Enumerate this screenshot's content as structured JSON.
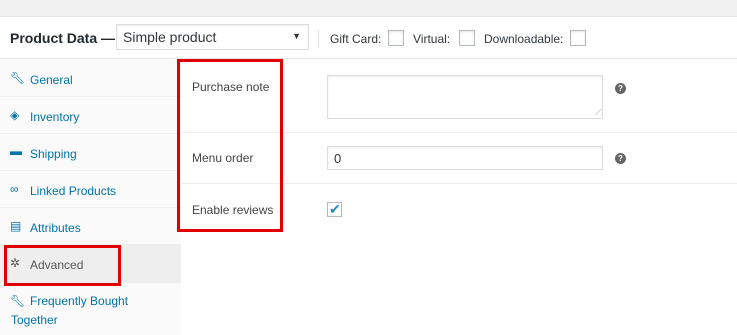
{
  "header": {
    "title": "Product Data —",
    "product_type": "Simple product",
    "options": [
      {
        "label": "Gift Card:",
        "checked": false
      },
      {
        "label": "Virtual:",
        "checked": false
      },
      {
        "label": "Downloadable:",
        "checked": false
      }
    ]
  },
  "sidebar": {
    "items": [
      {
        "label": "General",
        "icon": "wrench-icon",
        "active": false
      },
      {
        "label": "Inventory",
        "icon": "tag-icon",
        "active": false
      },
      {
        "label": "Shipping",
        "icon": "truck-icon",
        "active": false
      },
      {
        "label": "Linked Products",
        "icon": "link-icon",
        "active": false
      },
      {
        "label": "Attributes",
        "icon": "list-icon",
        "active": false
      },
      {
        "label": "Advanced",
        "icon": "gear-icon",
        "active": true
      },
      {
        "label": "Frequently Bought Together",
        "icon": "wrench-icon",
        "active": false
      }
    ]
  },
  "fields": {
    "purchase_note": {
      "label": "Purchase note",
      "value": ""
    },
    "menu_order": {
      "label": "Menu order",
      "value": "0"
    },
    "enable_reviews": {
      "label": "Enable reviews",
      "checked": true
    }
  },
  "help_icon": "?",
  "colors": {
    "link": "#0073aa",
    "highlight": "#e00000"
  }
}
